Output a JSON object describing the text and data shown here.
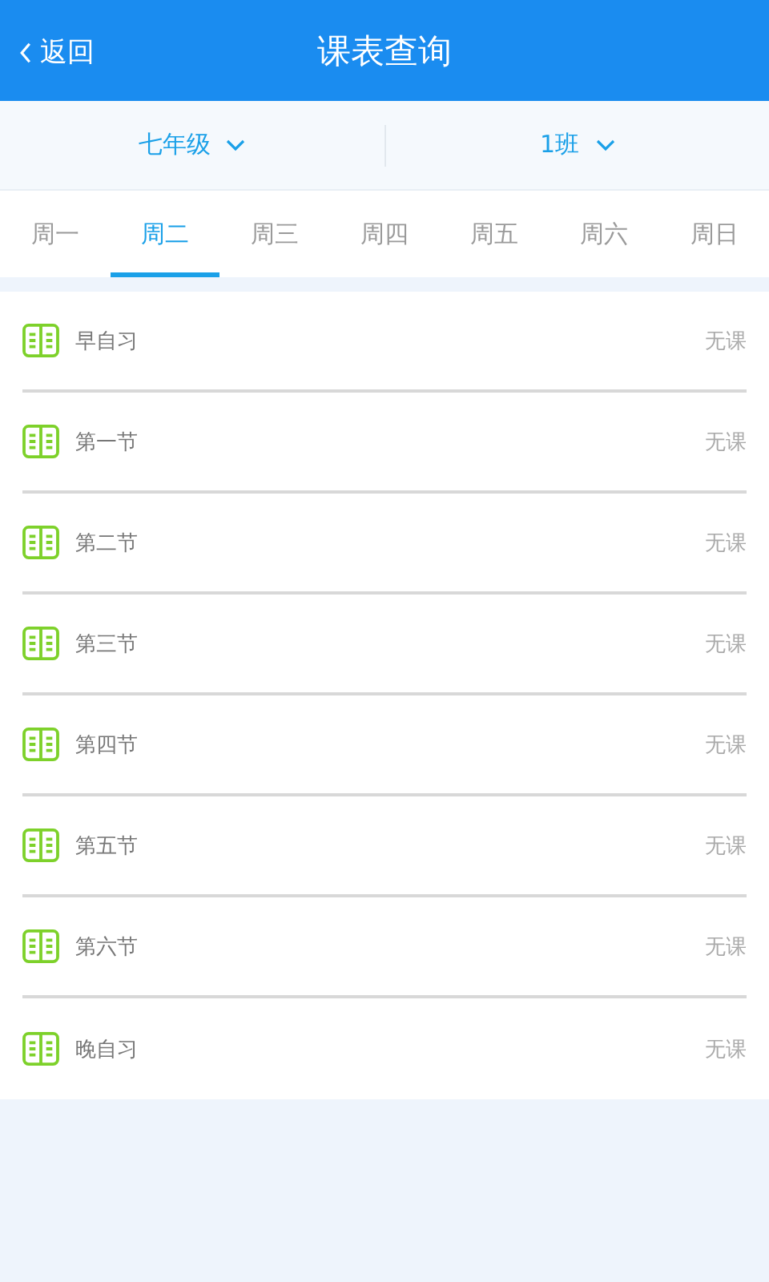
{
  "header": {
    "back": "返回",
    "title": "课表查询"
  },
  "filters": [
    {
      "label": "七年级"
    },
    {
      "label": "1班"
    }
  ],
  "tabs": [
    {
      "label": "周一",
      "selected": false
    },
    {
      "label": "周二",
      "selected": true
    },
    {
      "label": "周三",
      "selected": false
    },
    {
      "label": "周四",
      "selected": false
    },
    {
      "label": "周五",
      "selected": false
    },
    {
      "label": "周六",
      "selected": false
    },
    {
      "label": "周日",
      "selected": false
    }
  ],
  "periods": [
    {
      "name": "早自习",
      "course": "无课"
    },
    {
      "name": "第一节",
      "course": "无课"
    },
    {
      "name": "第二节",
      "course": "无课"
    },
    {
      "name": "第三节",
      "course": "无课"
    },
    {
      "name": "第四节",
      "course": "无课"
    },
    {
      "name": "第五节",
      "course": "无课"
    },
    {
      "name": "第六节",
      "course": "无课"
    },
    {
      "name": "晚自习",
      "course": "无课"
    }
  ]
}
